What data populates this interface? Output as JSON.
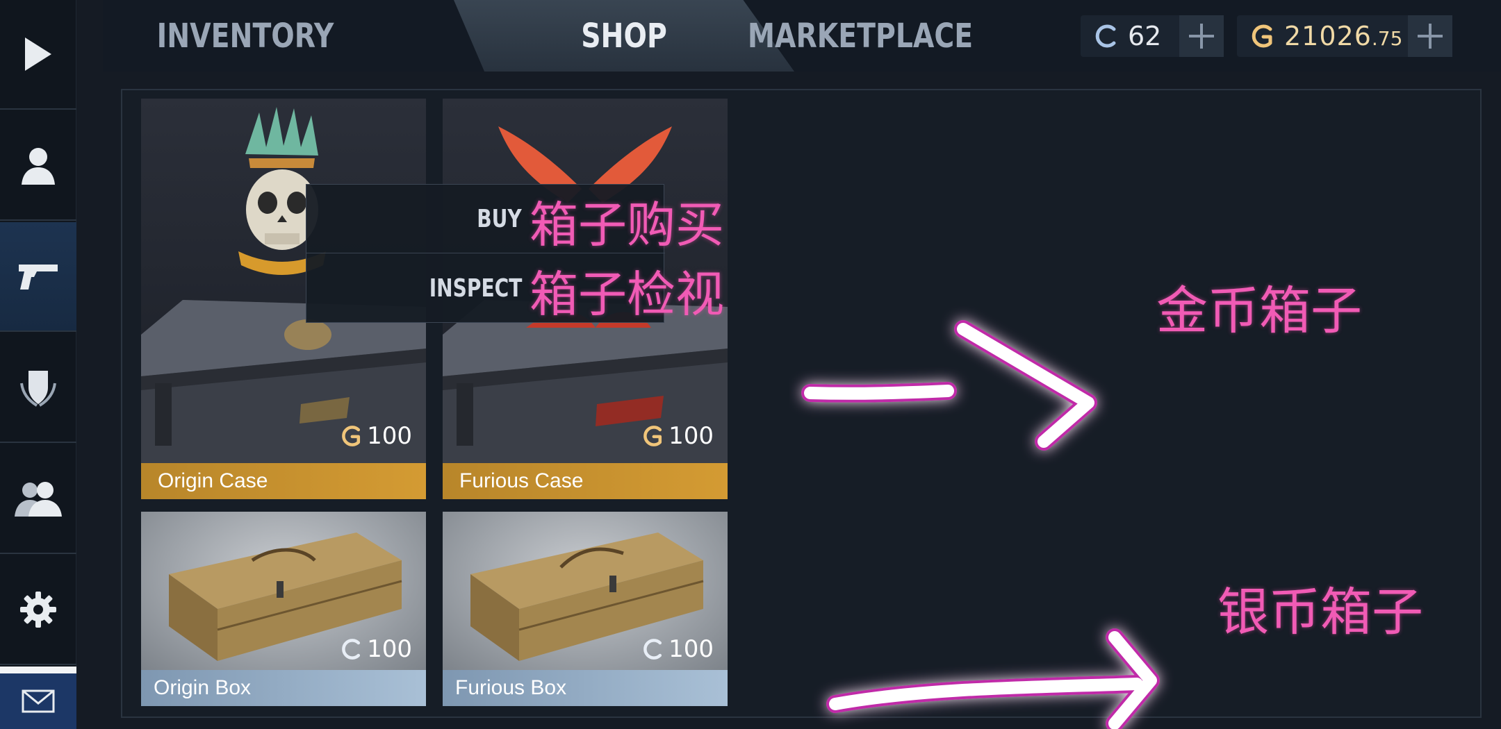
{
  "nav": {
    "items": [
      "play",
      "profile",
      "weapons",
      "rank",
      "friends",
      "settings",
      "mail"
    ],
    "active": "weapons"
  },
  "tabs": {
    "inventory": "INVENTORY",
    "shop": "SHOP",
    "marketplace": "MARKETPLACE",
    "active": "SHOP"
  },
  "currency": {
    "silver": "62",
    "gold_main": "21026",
    "gold_decimal": ".75"
  },
  "context_menu": {
    "buy": "BUY",
    "inspect": "INSPECT"
  },
  "shop_items": [
    {
      "name": "Origin Case",
      "price": "100",
      "currency": "gold"
    },
    {
      "name": "Furious Case",
      "price": "100",
      "currency": "gold"
    },
    {
      "name": "Origin Box",
      "price": "100",
      "currency": "silver"
    },
    {
      "name": "Furious Box",
      "price": "100",
      "currency": "silver"
    }
  ],
  "annotations": {
    "buy_note": "箱子购买",
    "inspect_note": "箱子检视",
    "gold_note": "金币箱子",
    "silver_note": "银币箱子"
  },
  "colors": {
    "gold_label": "#d49b33",
    "silver_label": "#a9c0d6",
    "annotation_pink": "#f15bb5",
    "accent_blue": "#1c3766"
  }
}
